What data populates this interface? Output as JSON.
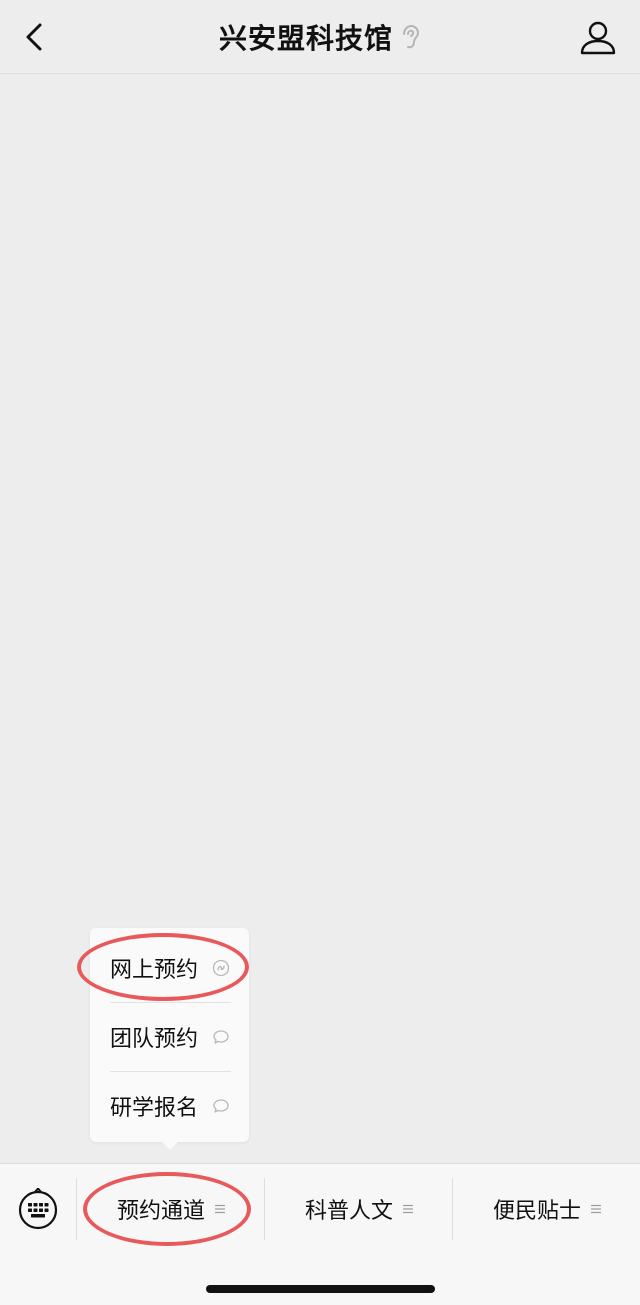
{
  "nav": {
    "title": "兴安盟科技馆",
    "back_icon": "chevron-left-icon",
    "profile_icon": "person-icon",
    "ear_icon": "ear-icon"
  },
  "popup_menu": {
    "items": [
      {
        "label": "网上预约",
        "icon": "mini-program-icon"
      },
      {
        "label": "团队预约",
        "icon": "chat-bubble-icon"
      },
      {
        "label": "研学报名",
        "icon": "chat-bubble-icon"
      }
    ]
  },
  "tabbar": {
    "keyboard_icon": "keyboard-icon",
    "tabs": [
      {
        "label": "预约通道",
        "icon": "menu-lines-icon"
      },
      {
        "label": "科普人文",
        "icon": "menu-lines-icon"
      },
      {
        "label": "便民贴士",
        "icon": "menu-lines-icon"
      }
    ]
  },
  "colors": {
    "background": "#ededed",
    "annotation": "#e8595c",
    "text": "#111111"
  }
}
